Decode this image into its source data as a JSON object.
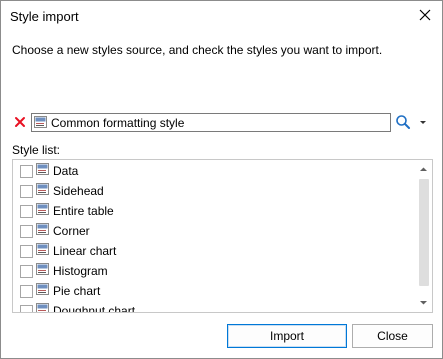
{
  "window": {
    "title": "Style import"
  },
  "instructions": "Choose a new styles source, and check the styles you want to import.",
  "source": {
    "value": "Common formatting style",
    "icons": {
      "remove": "red-x-icon",
      "style": "style-icon",
      "search": "search-icon",
      "dropdown": "chevron-down-icon"
    }
  },
  "style_list": {
    "label": "Style list:",
    "items": [
      {
        "label": "Data",
        "checked": false
      },
      {
        "label": "Sidehead",
        "checked": false
      },
      {
        "label": "Entire table",
        "checked": false
      },
      {
        "label": "Corner",
        "checked": false
      },
      {
        "label": "Linear chart",
        "checked": false
      },
      {
        "label": "Histogram",
        "checked": false
      },
      {
        "label": "Pie chart",
        "checked": false
      },
      {
        "label": "Doughnut chart",
        "checked": false
      }
    ]
  },
  "buttons": {
    "import": "Import",
    "close": "Close"
  },
  "colors": {
    "accent": "#0078d7",
    "remove": "#e81123"
  }
}
